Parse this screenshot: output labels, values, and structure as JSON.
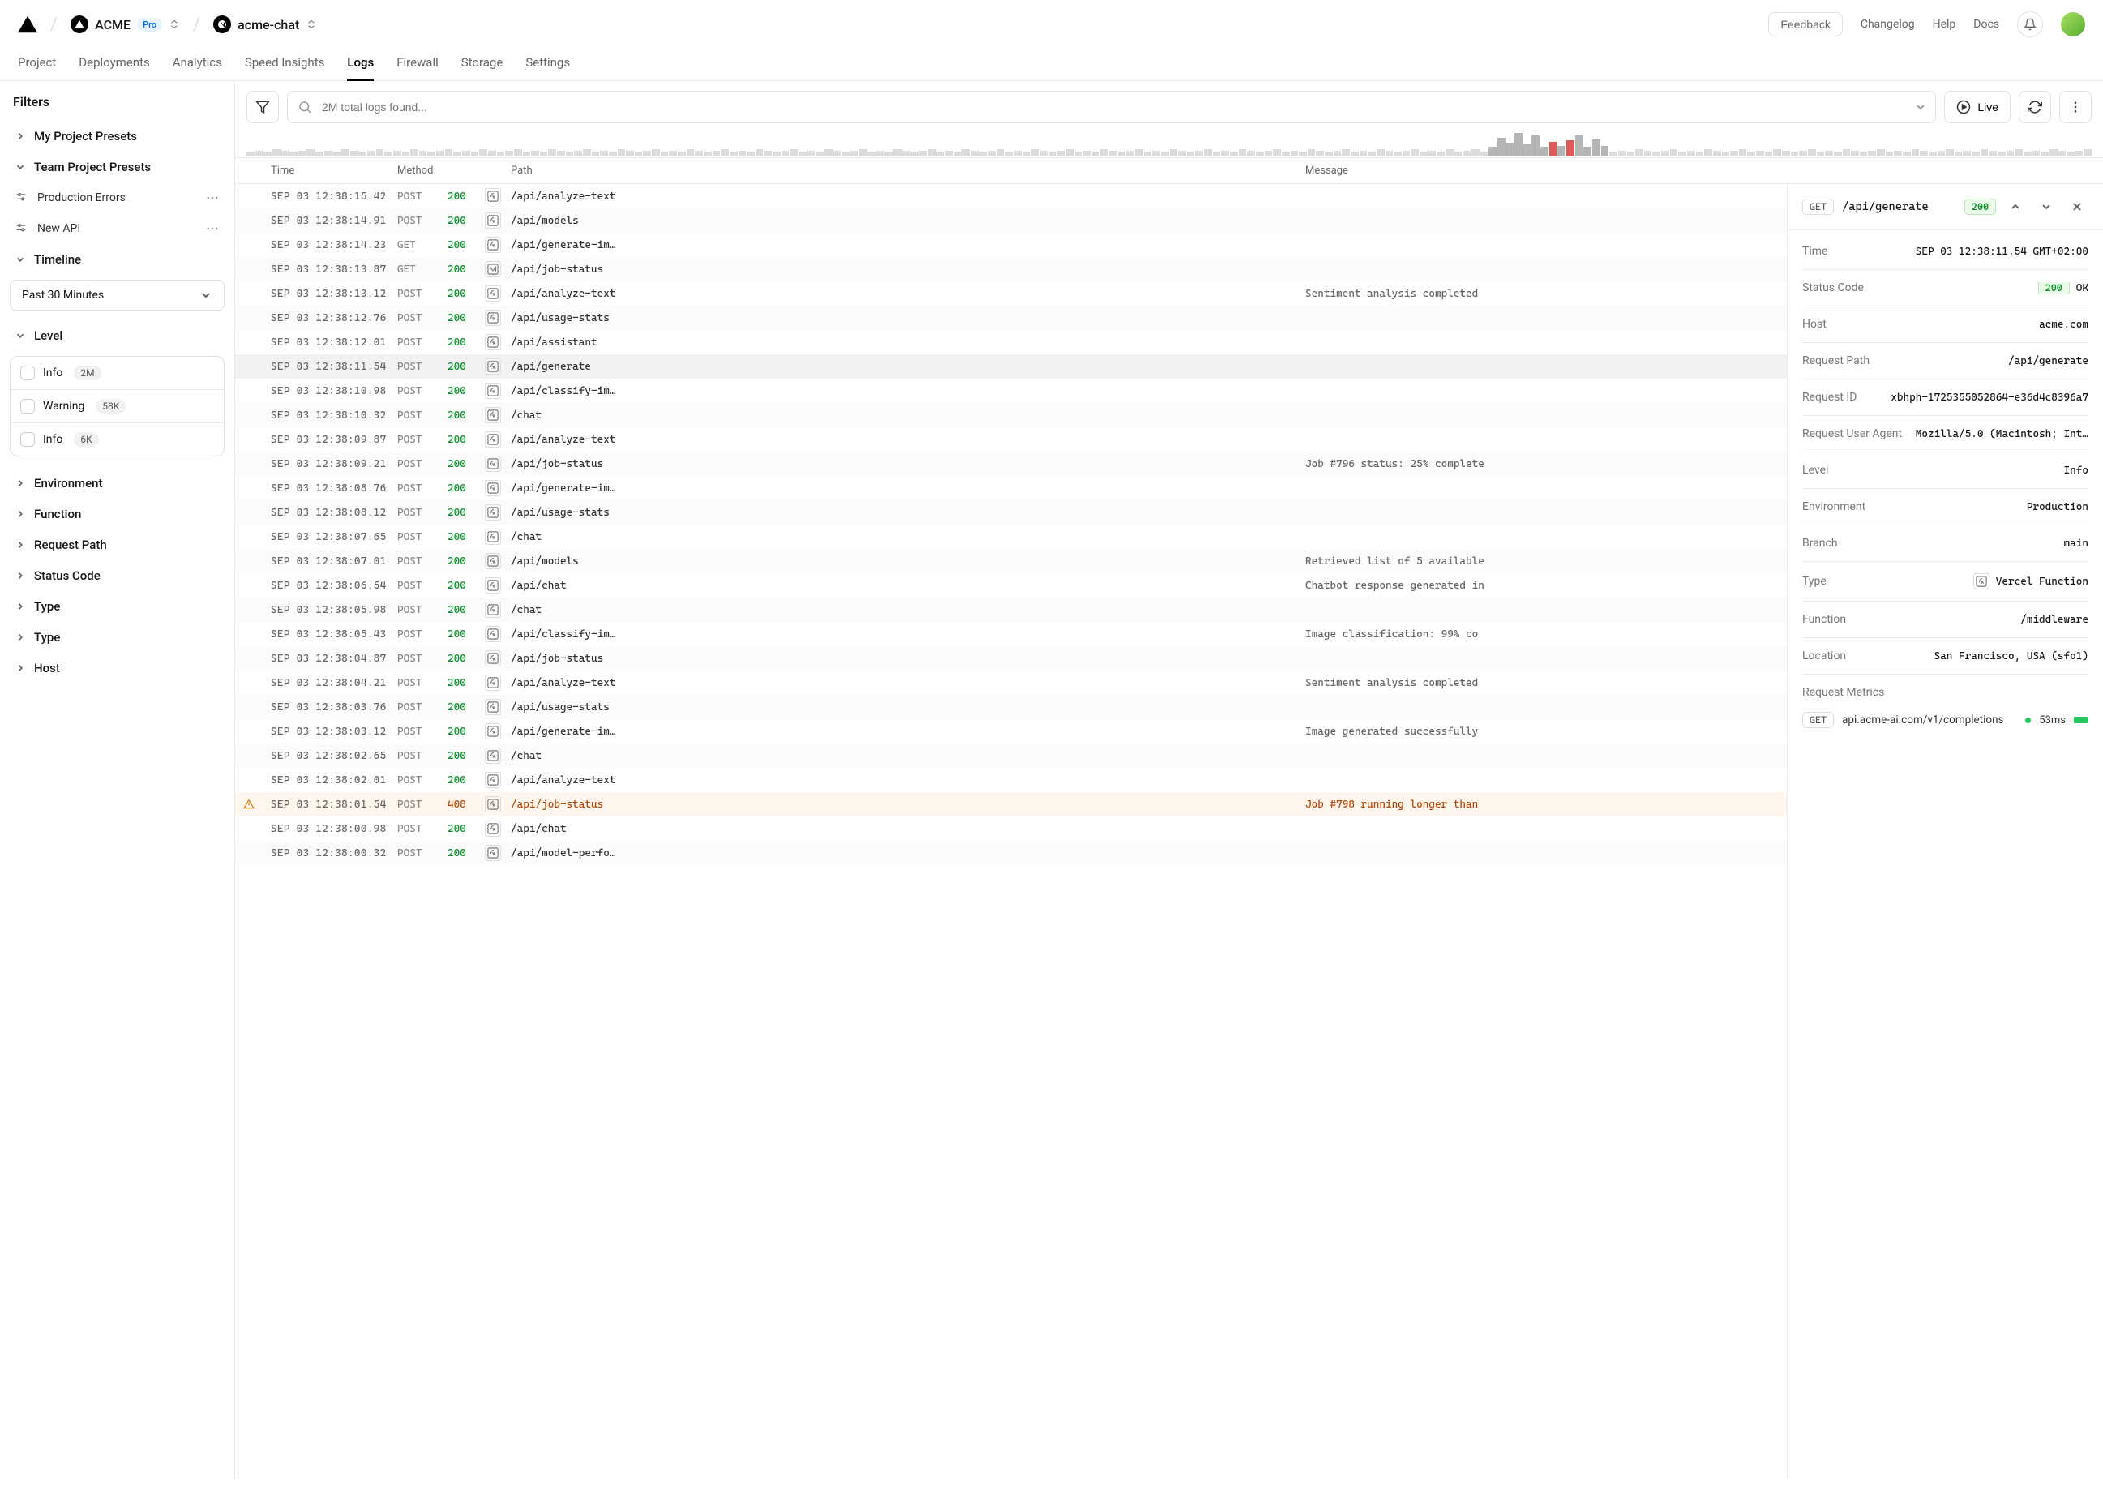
{
  "top": {
    "org": "ACME",
    "plan": "Pro",
    "project": "acme-chat",
    "feedback": "Feedback",
    "links": [
      "Changelog",
      "Help",
      "Docs"
    ]
  },
  "nav": [
    "Project",
    "Deployments",
    "Analytics",
    "Speed Insights",
    "Logs",
    "Firewall",
    "Storage",
    "Settings"
  ],
  "nav_active": "Logs",
  "sidebar": {
    "title": "Filters",
    "my_presets": "My Project Presets",
    "team_presets": "Team Project Presets",
    "presets": [
      "Production Errors",
      "New API"
    ],
    "timeline_label": "Timeline",
    "timeline_value": "Past 30 Minutes",
    "level_label": "Level",
    "levels": [
      {
        "label": "Info",
        "count": "2M"
      },
      {
        "label": "Warning",
        "count": "58K"
      },
      {
        "label": "Info",
        "count": "6K"
      }
    ],
    "collapsible": [
      "Environment",
      "Function",
      "Request Path",
      "Status Code",
      "Type",
      "Type",
      "Host"
    ]
  },
  "toolbar": {
    "search_placeholder": "2M total logs found...",
    "live": "Live"
  },
  "histogram": [
    3,
    4,
    3,
    5,
    4,
    3,
    4,
    5,
    3,
    4,
    3,
    5,
    4,
    3,
    4,
    5,
    3,
    4,
    3,
    5,
    4,
    3,
    4,
    5,
    3,
    4,
    3,
    5,
    4,
    3,
    4,
    5,
    3,
    4,
    3,
    5,
    4,
    3,
    4,
    5,
    3,
    4,
    3,
    5,
    4,
    3,
    4,
    5,
    3,
    4,
    3,
    5,
    4,
    3,
    4,
    5,
    3,
    4,
    3,
    5,
    4,
    3,
    4,
    5,
    3,
    4,
    3,
    5,
    4,
    3,
    4,
    5,
    3,
    4,
    3,
    5,
    4,
    3,
    4,
    5,
    3,
    4,
    3,
    5,
    4,
    3,
    4,
    5,
    3,
    4,
    3,
    5,
    4,
    3,
    4,
    5,
    3,
    4,
    3,
    5,
    4,
    3,
    4,
    5,
    3,
    4,
    3,
    5,
    4,
    3,
    4,
    5,
    3,
    4,
    3,
    5,
    4,
    3,
    4,
    5,
    3,
    4,
    3,
    5,
    4,
    3,
    4,
    5,
    3,
    4,
    3,
    5,
    4,
    3,
    4,
    5,
    3,
    4,
    3,
    5,
    3,
    4,
    5,
    3,
    7,
    14,
    10,
    18,
    9,
    16,
    7,
    "r11",
    8,
    "r12",
    16,
    7,
    13,
    8,
    3,
    4,
    3,
    5,
    4,
    3,
    4,
    5,
    3,
    4,
    3,
    5,
    4,
    3,
    4,
    5,
    3,
    4,
    3,
    5,
    4,
    3,
    4,
    5,
    3,
    4,
    3,
    5,
    4,
    3,
    4,
    5,
    3,
    4,
    3,
    5,
    4,
    3,
    4,
    5,
    3,
    4,
    3,
    5,
    4,
    3,
    4,
    5,
    3,
    4,
    3,
    5,
    4,
    3,
    4,
    5
  ],
  "columns": {
    "time": "Time",
    "method": "Method",
    "path": "Path",
    "message": "Message"
  },
  "rows": [
    {
      "time": "SEP 03 12:38:15.42",
      "method": "POST",
      "status": "200",
      "badge": "fn",
      "path": "/api/analyze-text",
      "msg": ""
    },
    {
      "time": "SEP 03 12:38:14.91",
      "method": "POST",
      "status": "200",
      "badge": "fn",
      "path": "/api/models",
      "msg": ""
    },
    {
      "time": "SEP 03 12:38:14.23",
      "method": "GET",
      "status": "200",
      "badge": "fn",
      "path": "/api/generate-im…",
      "msg": ""
    },
    {
      "time": "SEP 03 12:38:13.87",
      "method": "GET",
      "status": "200",
      "badge": "m",
      "path": "/api/job-status",
      "msg": ""
    },
    {
      "time": "SEP 03 12:38:13.12",
      "method": "POST",
      "status": "200",
      "badge": "fn",
      "path": "/api/analyze-text",
      "msg": "Sentiment analysis completed"
    },
    {
      "time": "SEP 03 12:38:12.76",
      "method": "POST",
      "status": "200",
      "badge": "fn",
      "path": "/api/usage-stats",
      "msg": ""
    },
    {
      "time": "SEP 03 12:38:12.01",
      "method": "POST",
      "status": "200",
      "badge": "fn",
      "path": "/api/assistant",
      "msg": ""
    },
    {
      "time": "SEP 03 12:38:11.54",
      "method": "POST",
      "status": "200",
      "badge": "fn",
      "path": "/api/generate",
      "msg": "",
      "selected": true
    },
    {
      "time": "SEP 03 12:38:10.98",
      "method": "POST",
      "status": "200",
      "badge": "fn",
      "path": "/api/classify-im…",
      "msg": ""
    },
    {
      "time": "SEP 03 12:38:10.32",
      "method": "POST",
      "status": "200",
      "badge": "fn",
      "path": "/chat",
      "msg": ""
    },
    {
      "time": "SEP 03 12:38:09.87",
      "method": "POST",
      "status": "200",
      "badge": "fn",
      "path": "/api/analyze-text",
      "msg": ""
    },
    {
      "time": "SEP 03 12:38:09.21",
      "method": "POST",
      "status": "200",
      "badge": "fn",
      "path": "/api/job-status",
      "msg": "Job #796 status: 25% complete"
    },
    {
      "time": "SEP 03 12:38:08.76",
      "method": "POST",
      "status": "200",
      "badge": "fn",
      "path": "/api/generate-im…",
      "msg": ""
    },
    {
      "time": "SEP 03 12:38:08.12",
      "method": "POST",
      "status": "200",
      "badge": "fn",
      "path": "/api/usage-stats",
      "msg": ""
    },
    {
      "time": "SEP 03 12:38:07.65",
      "method": "POST",
      "status": "200",
      "badge": "fn",
      "path": "/chat",
      "msg": ""
    },
    {
      "time": "SEP 03 12:38:07.01",
      "method": "POST",
      "status": "200",
      "badge": "fn",
      "path": "/api/models",
      "msg": "Retrieved list of 5 available"
    },
    {
      "time": "SEP 03 12:38:06.54",
      "method": "POST",
      "status": "200",
      "badge": "fn",
      "path": "/api/chat",
      "msg": "Chatbot response generated in"
    },
    {
      "time": "SEP 03 12:38:05.98",
      "method": "POST",
      "status": "200",
      "badge": "fn",
      "path": "/chat",
      "msg": ""
    },
    {
      "time": "SEP 03 12:38:05.43",
      "method": "POST",
      "status": "200",
      "badge": "fn",
      "path": "/api/classify-im…",
      "msg": "Image classification: 99% co"
    },
    {
      "time": "SEP 03 12:38:04.87",
      "method": "POST",
      "status": "200",
      "badge": "fn",
      "path": "/api/job-status",
      "msg": ""
    },
    {
      "time": "SEP 03 12:38:04.21",
      "method": "POST",
      "status": "200",
      "badge": "fn",
      "path": "/api/analyze-text",
      "msg": "Sentiment analysis completed"
    },
    {
      "time": "SEP 03 12:38:03.76",
      "method": "POST",
      "status": "200",
      "badge": "fn",
      "path": "/api/usage-stats",
      "msg": ""
    },
    {
      "time": "SEP 03 12:38:03.12",
      "method": "POST",
      "status": "200",
      "badge": "fn",
      "path": "/api/generate-im…",
      "msg": "Image generated successfully"
    },
    {
      "time": "SEP 03 12:38:02.65",
      "method": "POST",
      "status": "200",
      "badge": "fn",
      "path": "/chat",
      "msg": ""
    },
    {
      "time": "SEP 03 12:38:02.01",
      "method": "POST",
      "status": "200",
      "badge": "fn",
      "path": "/api/analyze-text",
      "msg": ""
    },
    {
      "time": "SEP 03 12:38:01.54",
      "method": "POST",
      "status": "408",
      "badge": "fn",
      "path": "/api/job-status",
      "msg": "Job #798 running longer than",
      "warn": true
    },
    {
      "time": "SEP 03 12:38:00.98",
      "method": "POST",
      "status": "200",
      "badge": "fn",
      "path": "/api/chat",
      "msg": ""
    },
    {
      "time": "SEP 03 12:38:00.32",
      "method": "POST",
      "status": "200",
      "badge": "fn",
      "path": "/api/model-perfo…",
      "msg": ""
    }
  ],
  "detail": {
    "method": "GET",
    "path": "/api/generate",
    "status": "200",
    "fields": [
      {
        "label": "Time",
        "value": "SEP 03 12:38:11.54 GMT+02:00",
        "mono": true
      },
      {
        "label": "Status Code",
        "value": "OK",
        "status": "200"
      },
      {
        "label": "Host",
        "value": "acme.com",
        "mono": true
      },
      {
        "label": "Request Path",
        "value": "/api/generate",
        "mono": true
      },
      {
        "label": "Request ID",
        "value": "xbhph-1725355052864-e36d4c8396a7",
        "mono": true
      },
      {
        "label": "Request User Agent",
        "value": "Mozilla/5.0 (Macintosh; Int…",
        "mono": true
      },
      {
        "label": "Level",
        "value": "Info",
        "mono": true
      },
      {
        "label": "Environment",
        "value": "Production",
        "mono": true
      },
      {
        "label": "Branch",
        "value": "main",
        "mono": true
      },
      {
        "label": "Type",
        "value": "Vercel Function",
        "mono": true,
        "icon": "fn"
      },
      {
        "label": "Function",
        "value": "/middleware",
        "mono": true
      },
      {
        "label": "Location",
        "value": "San Francisco, USA (sfo1)",
        "mono": true
      }
    ],
    "metrics_label": "Request Metrics",
    "metric": {
      "method": "GET",
      "url": "api.acme-ai.com/v1/completions",
      "time": "53ms"
    }
  }
}
